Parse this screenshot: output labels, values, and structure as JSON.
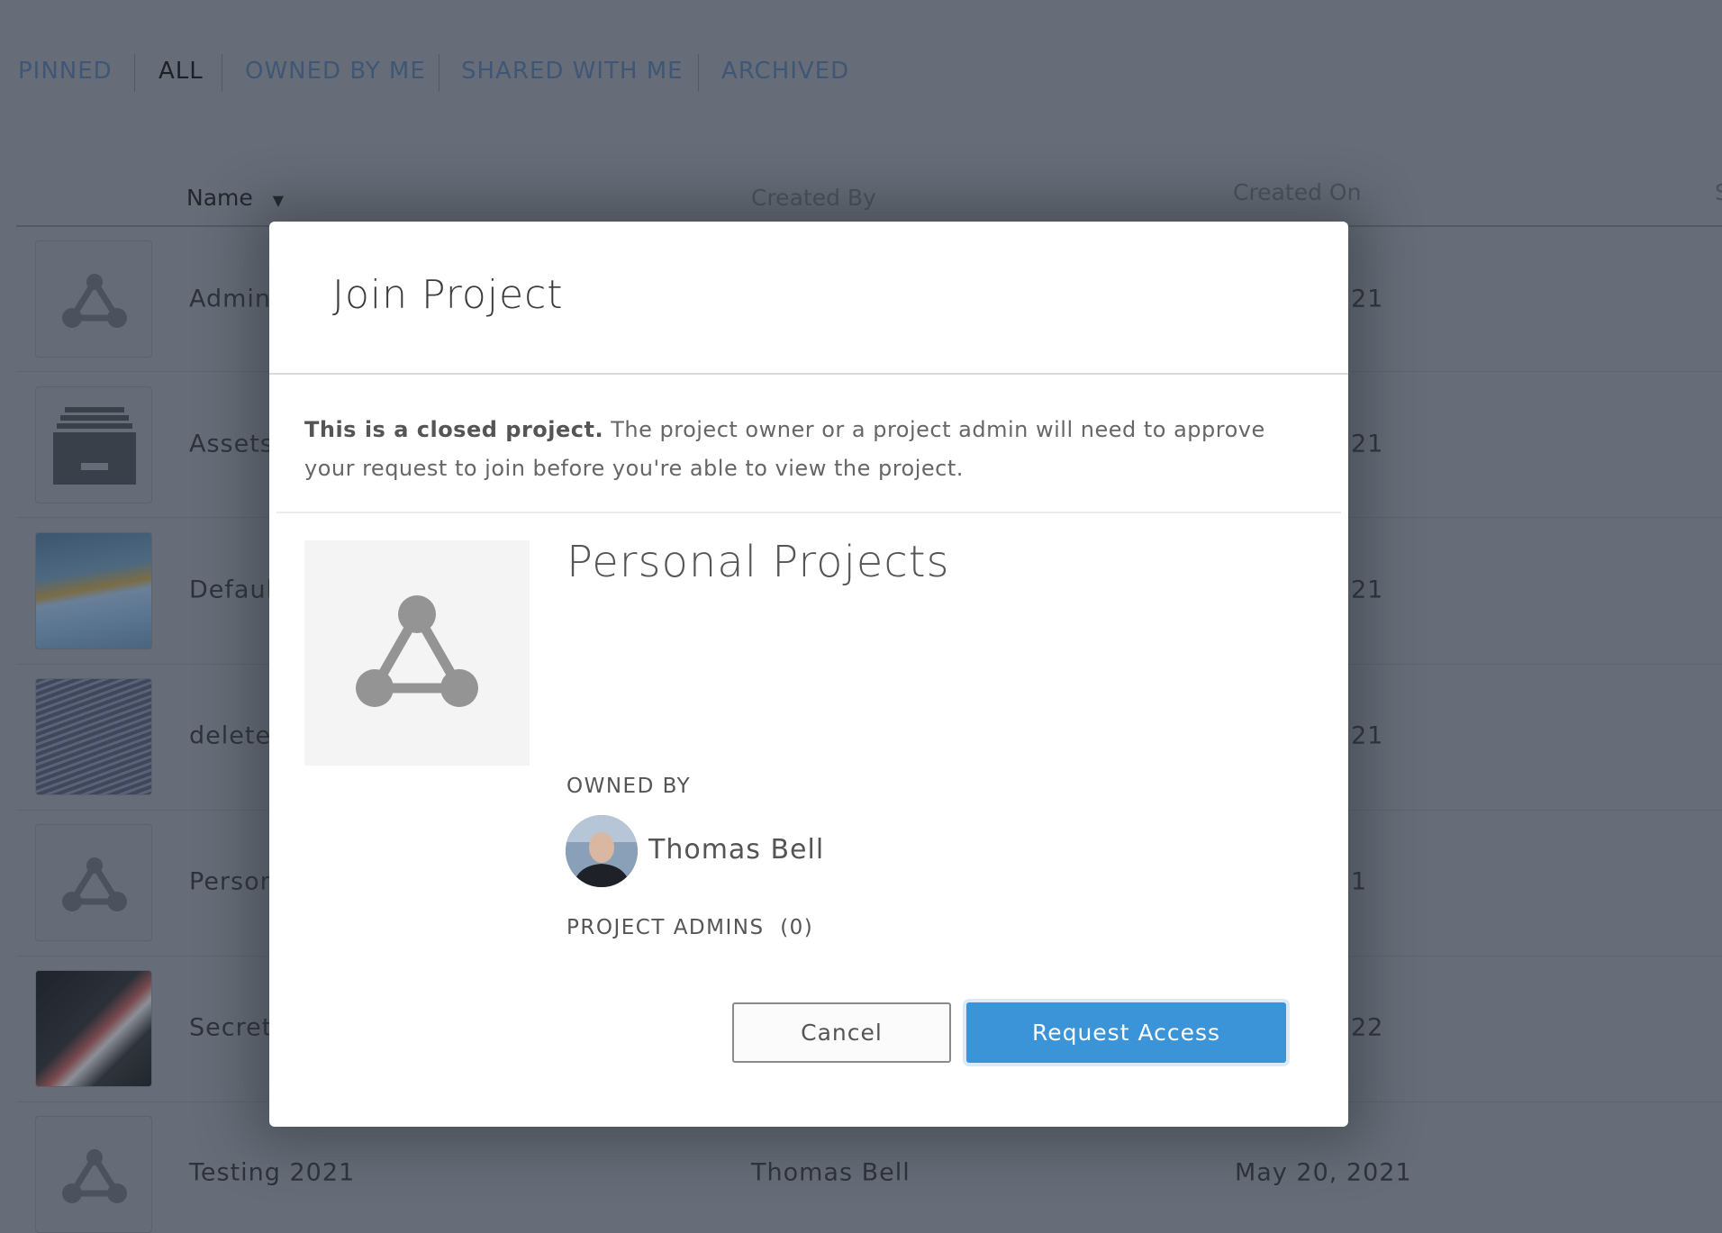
{
  "tabs": [
    {
      "label": "PINNED",
      "active": false
    },
    {
      "label": "ALL",
      "active": true
    },
    {
      "label": "OWNED BY ME",
      "active": false
    },
    {
      "label": "SHARED WITH ME",
      "active": false
    },
    {
      "label": "ARCHIVED",
      "active": false
    }
  ],
  "table": {
    "columns": {
      "name": "Name",
      "created_by": "Created By",
      "created_on": "Created On",
      "partial": "S"
    },
    "sort_icon": "caret-down-icon",
    "rows": [
      {
        "name": "Admin",
        "thumb": "project-icon",
        "created_on": "21"
      },
      {
        "name": "Assets",
        "thumb": "archive-icon",
        "created_on": "21"
      },
      {
        "name": "Defaul",
        "thumb": "image-dunes",
        "created_on": "21"
      },
      {
        "name": "delete",
        "thumb": "image-solar-panels",
        "created_on": "21"
      },
      {
        "name": "Person",
        "thumb": "project-icon",
        "created_on": "1"
      },
      {
        "name": "Secret",
        "thumb": "image-abstract",
        "created_on": "22"
      },
      {
        "name": "Testing 2021",
        "thumb": "project-icon",
        "created_by": "Thomas Bell",
        "created_on": "May 20, 2021"
      }
    ]
  },
  "dialog": {
    "title": "Join Project",
    "message_bold": "This is a closed project.",
    "message": " The project owner or a project admin will need to approve your request to join before you're able to view the project.",
    "project_name": "Personal Projects",
    "owned_by_label": "OWNED BY",
    "owner_name": "Thomas Bell",
    "admins_label": "PROJECT ADMINS",
    "admins_count": "(0)",
    "cancel_label": "Cancel",
    "request_label": "Request Access",
    "accent_color": "#3c94d8"
  }
}
